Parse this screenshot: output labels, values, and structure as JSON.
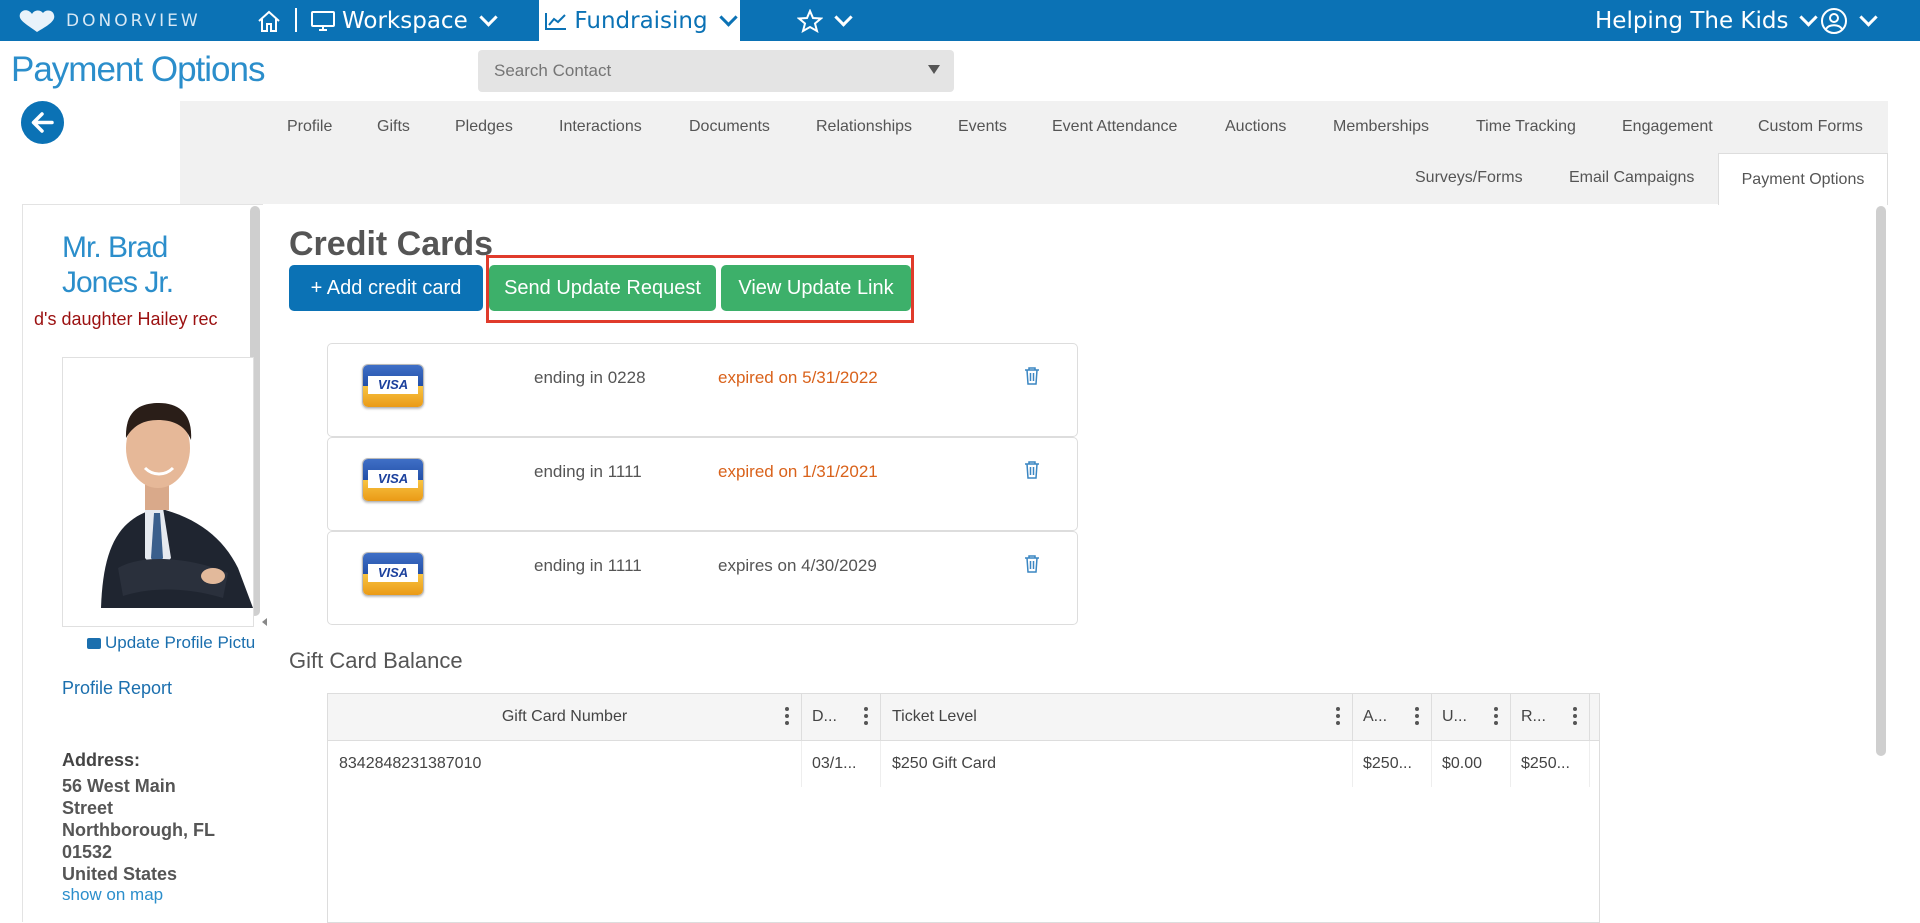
{
  "topbar": {
    "logo_text": "DONORVIEW",
    "workspace_label": "Workspace",
    "fundraising_label": "Fundraising",
    "org_name": "Helping The Kids",
    "colors": {
      "bar": "#0b72b5",
      "active": "#ffffff"
    }
  },
  "header": {
    "page_title": "Payment Options",
    "search_placeholder": "Search Contact"
  },
  "tabs": {
    "row1": [
      "Profile",
      "Gifts",
      "Pledges",
      "Interactions",
      "Documents",
      "Relationships",
      "Events",
      "Event Attendance",
      "Auctions",
      "Memberships",
      "Time Tracking",
      "Engagement",
      "Custom Forms"
    ],
    "row2": [
      "Surveys/Forms",
      "Email Campaigns",
      "Payment Options"
    ],
    "active": "Payment Options"
  },
  "contact": {
    "name_line1": "Mr. Brad",
    "name_line2": "Jones Jr.",
    "note": "d's daughter Hailey rec",
    "update_picture": "Update Profile Pictu",
    "profile_report": "Profile Report",
    "address_label": "Address:",
    "address_lines": [
      "56 West Main",
      "Street",
      "Northborough, FL",
      "01532",
      "United States"
    ],
    "show_on_map": "show on map"
  },
  "credit_cards": {
    "title": "Credit Cards",
    "add_button": "+ Add credit card",
    "send_update_button": "Send Update Request",
    "view_link_button": "View Update Link",
    "cards": [
      {
        "brand": "VISA",
        "ending": "ending in 0228",
        "expiry": "expired on 5/31/2022",
        "expired": true
      },
      {
        "brand": "VISA",
        "ending": "ending in 1111",
        "expiry": "expired on 1/31/2021",
        "expired": true
      },
      {
        "brand": "VISA",
        "ending": "ending in 1111",
        "expiry": "expires on 4/30/2029",
        "expired": false
      }
    ],
    "colors": {
      "expired": "#d9621b",
      "valid": "#555555"
    }
  },
  "gift_card": {
    "title": "Gift Card Balance",
    "columns": [
      "Gift Card Number",
      "D...",
      "Ticket Level",
      "A...",
      "U...",
      "R..."
    ],
    "rows": [
      [
        "8342848231387010",
        "03/1...",
        "$250 Gift Card",
        "$250...",
        "$0.00",
        "$250..."
      ]
    ]
  }
}
